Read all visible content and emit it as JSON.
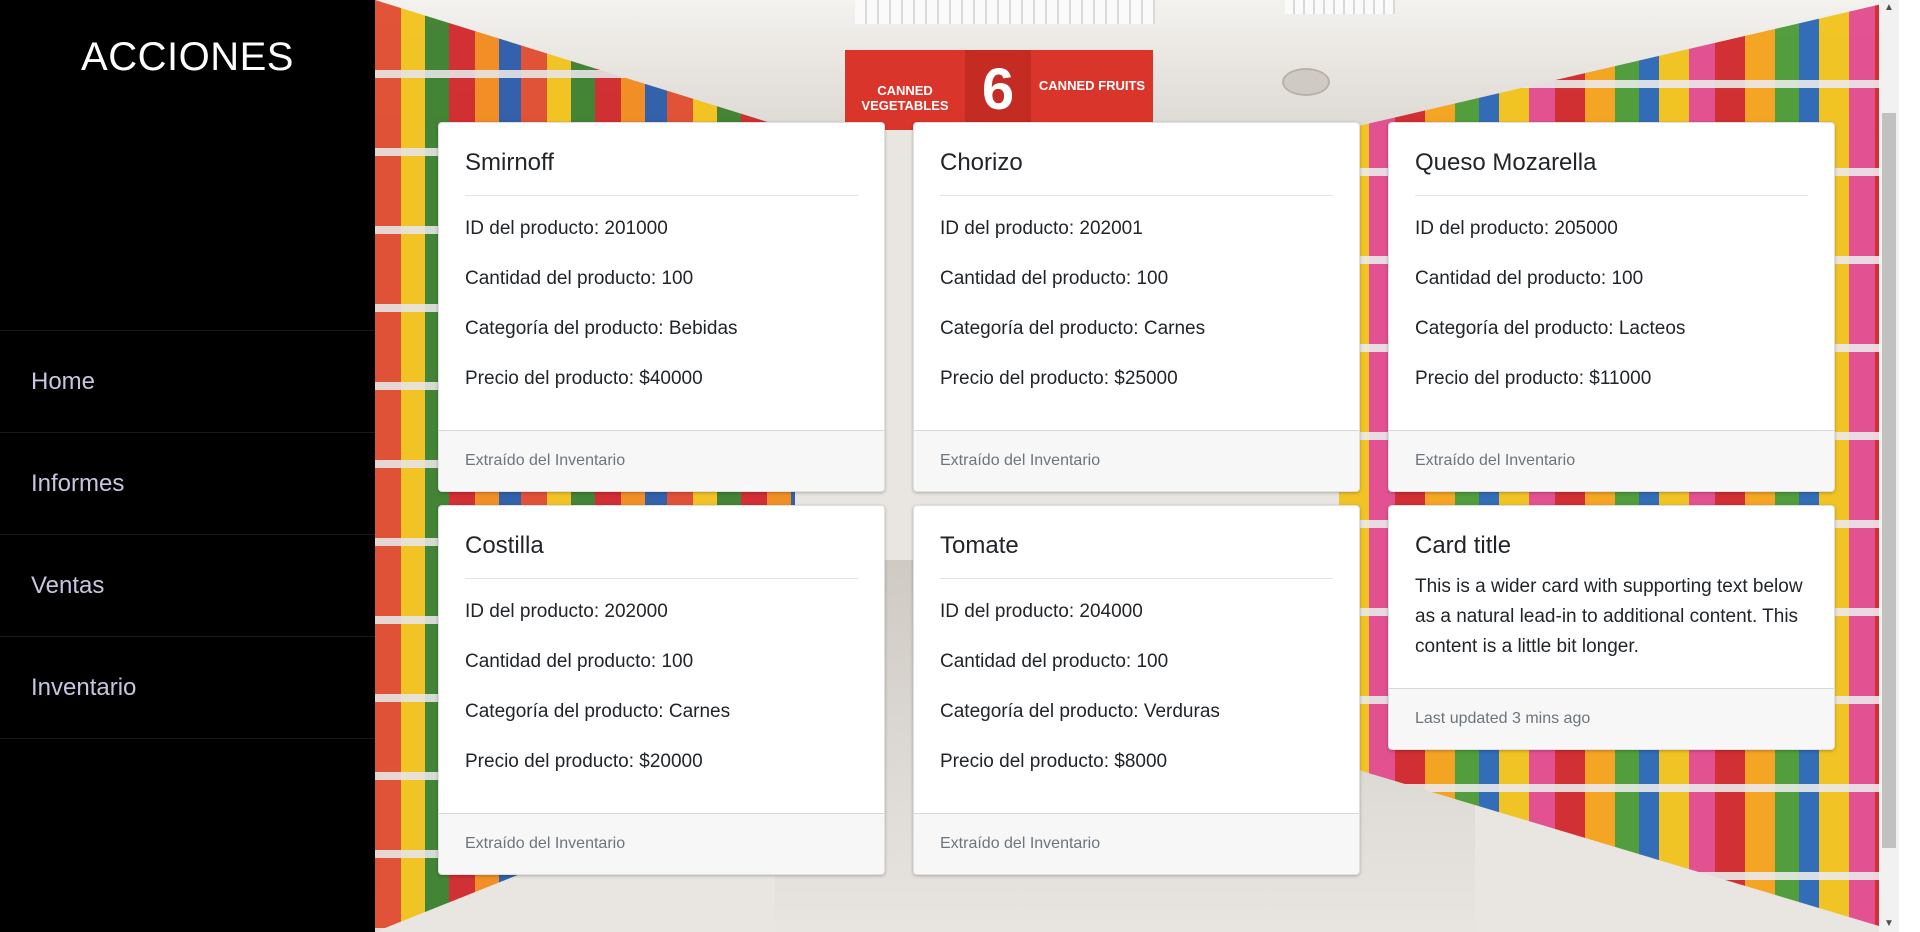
{
  "sidebar": {
    "title": "ACCIONES",
    "items": [
      {
        "label": "Home"
      },
      {
        "label": "Informes"
      },
      {
        "label": "Ventas"
      },
      {
        "label": "Inventario"
      }
    ]
  },
  "background": {
    "sign_left": "CANNED VEGETABLES",
    "sign_number": "6",
    "sign_right": "CANNED FRUITS"
  },
  "cards": [
    {
      "title": "Smirnoff",
      "id_line": "ID del producto: 201000",
      "qty_line": "Cantidad del producto: 100",
      "cat_line": "Categoría del producto: Bebidas",
      "price_line": "Precio del producto: $40000",
      "footer": "Extraído del Inventario"
    },
    {
      "title": "Chorizo",
      "id_line": "ID del producto: 202001",
      "qty_line": "Cantidad del producto: 100",
      "cat_line": "Categoría del producto: Carnes",
      "price_line": "Precio del producto: $25000",
      "footer": "Extraído del Inventario"
    },
    {
      "title": "Queso Mozarella",
      "id_line": "ID del producto: 205000",
      "qty_line": "Cantidad del producto: 100",
      "cat_line": "Categoría del producto: Lacteos",
      "price_line": "Precio del producto: $11000",
      "footer": "Extraído del Inventario"
    },
    {
      "title": "Costilla",
      "id_line": "ID del producto: 202000",
      "qty_line": "Cantidad del producto: 100",
      "cat_line": "Categoría del producto: Carnes",
      "price_line": "Precio del producto: $20000",
      "footer": "Extraído del Inventario"
    },
    {
      "title": "Tomate",
      "id_line": "ID del producto: 204000",
      "qty_line": "Cantidad del producto: 100",
      "cat_line": "Categoría del producto: Verduras",
      "price_line": "Precio del producto: $8000",
      "footer": "Extraído del Inventario"
    }
  ],
  "wide_card": {
    "title": "Card title",
    "text": "This is a wider card with supporting text below as a natural lead-in to additional content. This content is a little bit longer.",
    "footer": "Last updated 3 mins ago"
  },
  "scrollbar": {
    "up_icon": "triangle-up",
    "down_icon": "triangle-down"
  }
}
